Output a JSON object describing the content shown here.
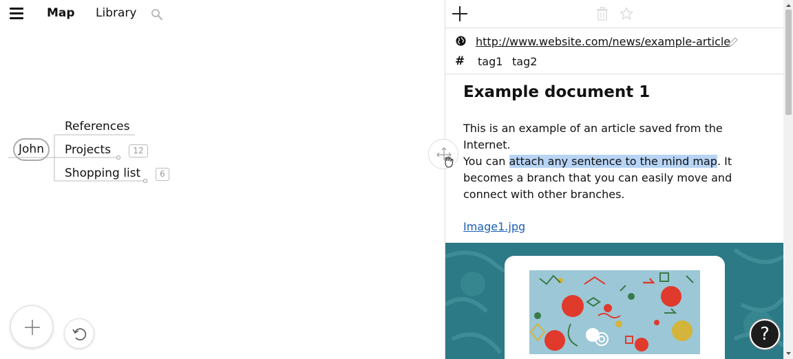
{
  "nav": {
    "menu_icon": "hamburger-menu-icon",
    "map_tab": "Map",
    "library_tab": "Library",
    "search_icon": "search-icon"
  },
  "map": {
    "root": "John",
    "branches": [
      {
        "label": "References",
        "count": ""
      },
      {
        "label": "Projects",
        "count": "12"
      },
      {
        "label": "Shopping list",
        "count": "6"
      }
    ],
    "add_icon": "plus-icon",
    "undo_icon": "undo-icon",
    "drag_icon": "move-hand-icon"
  },
  "document": {
    "toolbar": {
      "add_icon": "plus-icon",
      "trash_icon": "trash-icon",
      "star_icon": "star-icon"
    },
    "url": "http://www.website.com/news/example-article",
    "tags": [
      "tag1",
      "tag2"
    ],
    "title": "Example document 1",
    "para1": "This is an example of an article saved from the Internet.",
    "para2_before": "You can ",
    "para2_highlight": "attach any sentence to the mind map",
    "para2_after": ". It becomes a branch that you can easily move and connect with other branches.",
    "image_link": "Image1.jpg",
    "help_label": "?"
  },
  "colors": {
    "highlight": "#b7d4f5",
    "link": "#1a5fb4",
    "hero_bg": "#2b7a86"
  }
}
